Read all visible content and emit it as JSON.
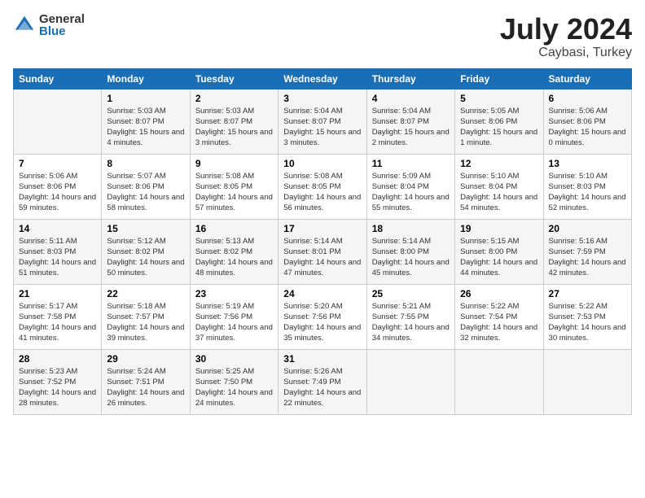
{
  "logo": {
    "general": "General",
    "blue": "Blue"
  },
  "title": "July 2024",
  "location": "Caybasi, Turkey",
  "days_of_week": [
    "Sunday",
    "Monday",
    "Tuesday",
    "Wednesday",
    "Thursday",
    "Friday",
    "Saturday"
  ],
  "weeks": [
    [
      {
        "day": "",
        "sunrise": "",
        "sunset": "",
        "daylight": ""
      },
      {
        "day": "1",
        "sunrise": "Sunrise: 5:03 AM",
        "sunset": "Sunset: 8:07 PM",
        "daylight": "Daylight: 15 hours and 4 minutes."
      },
      {
        "day": "2",
        "sunrise": "Sunrise: 5:03 AM",
        "sunset": "Sunset: 8:07 PM",
        "daylight": "Daylight: 15 hours and 3 minutes."
      },
      {
        "day": "3",
        "sunrise": "Sunrise: 5:04 AM",
        "sunset": "Sunset: 8:07 PM",
        "daylight": "Daylight: 15 hours and 3 minutes."
      },
      {
        "day": "4",
        "sunrise": "Sunrise: 5:04 AM",
        "sunset": "Sunset: 8:07 PM",
        "daylight": "Daylight: 15 hours and 2 minutes."
      },
      {
        "day": "5",
        "sunrise": "Sunrise: 5:05 AM",
        "sunset": "Sunset: 8:06 PM",
        "daylight": "Daylight: 15 hours and 1 minute."
      },
      {
        "day": "6",
        "sunrise": "Sunrise: 5:06 AM",
        "sunset": "Sunset: 8:06 PM",
        "daylight": "Daylight: 15 hours and 0 minutes."
      }
    ],
    [
      {
        "day": "7",
        "sunrise": "Sunrise: 5:06 AM",
        "sunset": "Sunset: 8:06 PM",
        "daylight": "Daylight: 14 hours and 59 minutes."
      },
      {
        "day": "8",
        "sunrise": "Sunrise: 5:07 AM",
        "sunset": "Sunset: 8:06 PM",
        "daylight": "Daylight: 14 hours and 58 minutes."
      },
      {
        "day": "9",
        "sunrise": "Sunrise: 5:08 AM",
        "sunset": "Sunset: 8:05 PM",
        "daylight": "Daylight: 14 hours and 57 minutes."
      },
      {
        "day": "10",
        "sunrise": "Sunrise: 5:08 AM",
        "sunset": "Sunset: 8:05 PM",
        "daylight": "Daylight: 14 hours and 56 minutes."
      },
      {
        "day": "11",
        "sunrise": "Sunrise: 5:09 AM",
        "sunset": "Sunset: 8:04 PM",
        "daylight": "Daylight: 14 hours and 55 minutes."
      },
      {
        "day": "12",
        "sunrise": "Sunrise: 5:10 AM",
        "sunset": "Sunset: 8:04 PM",
        "daylight": "Daylight: 14 hours and 54 minutes."
      },
      {
        "day": "13",
        "sunrise": "Sunrise: 5:10 AM",
        "sunset": "Sunset: 8:03 PM",
        "daylight": "Daylight: 14 hours and 52 minutes."
      }
    ],
    [
      {
        "day": "14",
        "sunrise": "Sunrise: 5:11 AM",
        "sunset": "Sunset: 8:03 PM",
        "daylight": "Daylight: 14 hours and 51 minutes."
      },
      {
        "day": "15",
        "sunrise": "Sunrise: 5:12 AM",
        "sunset": "Sunset: 8:02 PM",
        "daylight": "Daylight: 14 hours and 50 minutes."
      },
      {
        "day": "16",
        "sunrise": "Sunrise: 5:13 AM",
        "sunset": "Sunset: 8:02 PM",
        "daylight": "Daylight: 14 hours and 48 minutes."
      },
      {
        "day": "17",
        "sunrise": "Sunrise: 5:14 AM",
        "sunset": "Sunset: 8:01 PM",
        "daylight": "Daylight: 14 hours and 47 minutes."
      },
      {
        "day": "18",
        "sunrise": "Sunrise: 5:14 AM",
        "sunset": "Sunset: 8:00 PM",
        "daylight": "Daylight: 14 hours and 45 minutes."
      },
      {
        "day": "19",
        "sunrise": "Sunrise: 5:15 AM",
        "sunset": "Sunset: 8:00 PM",
        "daylight": "Daylight: 14 hours and 44 minutes."
      },
      {
        "day": "20",
        "sunrise": "Sunrise: 5:16 AM",
        "sunset": "Sunset: 7:59 PM",
        "daylight": "Daylight: 14 hours and 42 minutes."
      }
    ],
    [
      {
        "day": "21",
        "sunrise": "Sunrise: 5:17 AM",
        "sunset": "Sunset: 7:58 PM",
        "daylight": "Daylight: 14 hours and 41 minutes."
      },
      {
        "day": "22",
        "sunrise": "Sunrise: 5:18 AM",
        "sunset": "Sunset: 7:57 PM",
        "daylight": "Daylight: 14 hours and 39 minutes."
      },
      {
        "day": "23",
        "sunrise": "Sunrise: 5:19 AM",
        "sunset": "Sunset: 7:56 PM",
        "daylight": "Daylight: 14 hours and 37 minutes."
      },
      {
        "day": "24",
        "sunrise": "Sunrise: 5:20 AM",
        "sunset": "Sunset: 7:56 PM",
        "daylight": "Daylight: 14 hours and 35 minutes."
      },
      {
        "day": "25",
        "sunrise": "Sunrise: 5:21 AM",
        "sunset": "Sunset: 7:55 PM",
        "daylight": "Daylight: 14 hours and 34 minutes."
      },
      {
        "day": "26",
        "sunrise": "Sunrise: 5:22 AM",
        "sunset": "Sunset: 7:54 PM",
        "daylight": "Daylight: 14 hours and 32 minutes."
      },
      {
        "day": "27",
        "sunrise": "Sunrise: 5:22 AM",
        "sunset": "Sunset: 7:53 PM",
        "daylight": "Daylight: 14 hours and 30 minutes."
      }
    ],
    [
      {
        "day": "28",
        "sunrise": "Sunrise: 5:23 AM",
        "sunset": "Sunset: 7:52 PM",
        "daylight": "Daylight: 14 hours and 28 minutes."
      },
      {
        "day": "29",
        "sunrise": "Sunrise: 5:24 AM",
        "sunset": "Sunset: 7:51 PM",
        "daylight": "Daylight: 14 hours and 26 minutes."
      },
      {
        "day": "30",
        "sunrise": "Sunrise: 5:25 AM",
        "sunset": "Sunset: 7:50 PM",
        "daylight": "Daylight: 14 hours and 24 minutes."
      },
      {
        "day": "31",
        "sunrise": "Sunrise: 5:26 AM",
        "sunset": "Sunset: 7:49 PM",
        "daylight": "Daylight: 14 hours and 22 minutes."
      },
      {
        "day": "",
        "sunrise": "",
        "sunset": "",
        "daylight": ""
      },
      {
        "day": "",
        "sunrise": "",
        "sunset": "",
        "daylight": ""
      },
      {
        "day": "",
        "sunrise": "",
        "sunset": "",
        "daylight": ""
      }
    ]
  ]
}
